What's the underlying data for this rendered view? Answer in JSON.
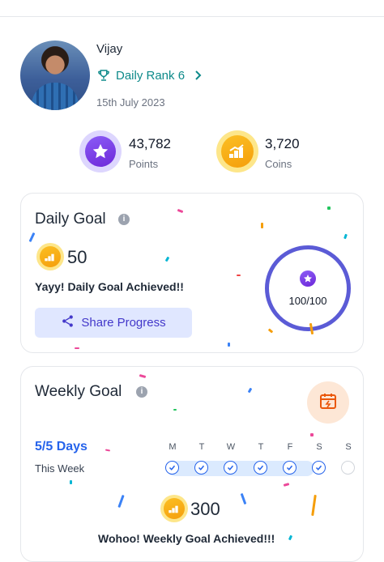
{
  "profile": {
    "name": "Vijay",
    "rank_label": "Daily Rank 6",
    "date": "15th July 2023"
  },
  "stats": {
    "points_value": "43,782",
    "points_label": "Points",
    "coins_value": "3,720",
    "coins_label": "Coins"
  },
  "daily_goal": {
    "title": "Daily Goal",
    "coins": "50",
    "message": "Yayy! Daily Goal Achieved!!",
    "share_label": "Share Progress",
    "progress_text": "100/100",
    "progress_fraction": 1.0
  },
  "weekly_goal": {
    "title": "Weekly Goal",
    "days_done": "5/5 Days",
    "period": "This Week",
    "days": [
      {
        "label": "M",
        "done": true
      },
      {
        "label": "T",
        "done": true
      },
      {
        "label": "W",
        "done": true
      },
      {
        "label": "T",
        "done": true
      },
      {
        "label": "F",
        "done": true
      },
      {
        "label": "S",
        "done": true
      },
      {
        "label": "S",
        "done": false
      }
    ],
    "coins": "300",
    "message": "Wohoo! Weekly Goal Achieved!!!"
  },
  "colors": {
    "accent_teal": "#0e8a8a",
    "ring_purple": "#5b5bd6",
    "week_blue": "#2563eb",
    "coin_gold": "#f59e0b"
  },
  "icons": {
    "rank": "trophy-icon",
    "points": "star-icon",
    "coins": "coin-icon",
    "share": "share-icon",
    "calendar": "calendar-icon",
    "check": "check-icon"
  }
}
